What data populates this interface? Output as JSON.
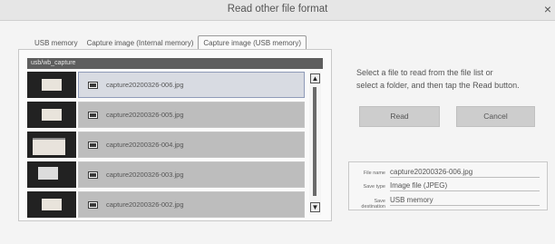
{
  "window": {
    "title": "Read other file format",
    "close": "×"
  },
  "tabs": [
    {
      "label": "USB memory",
      "active": false
    },
    {
      "label": "Capture image (Internal memory)",
      "active": false
    },
    {
      "label": "Capture image (USB memory)",
      "active": true
    }
  ],
  "path": "usb/wb_capture",
  "files": [
    {
      "name": "capture20200326-006.jpg",
      "selected": true
    },
    {
      "name": "capture20200326-005.jpg",
      "selected": false
    },
    {
      "name": "capture20200326-004.jpg",
      "selected": false
    },
    {
      "name": "capture20200326-003.jpg",
      "selected": false
    },
    {
      "name": "capture20200326-002.jpg",
      "selected": false
    }
  ],
  "scroll": {
    "up": "▲",
    "down": "▼"
  },
  "hint": {
    "line1": "Select a file to read from the file list or",
    "line2": "select a folder, and then tap the Read button."
  },
  "buttons": {
    "read": "Read",
    "cancel": "Cancel"
  },
  "info": {
    "file_name_label": "File name",
    "file_name": "capture20200326-006.jpg",
    "save_type_label": "Save type",
    "save_type": "Image file (JPEG)",
    "save_destination_label": "Save destination",
    "save_destination": "USB memory"
  },
  "colors": {
    "row_background": "#bdbdbd",
    "selected_row": "#d8dbe2",
    "path_bar": "#5e5e5e",
    "button": "#cdcdcd"
  }
}
